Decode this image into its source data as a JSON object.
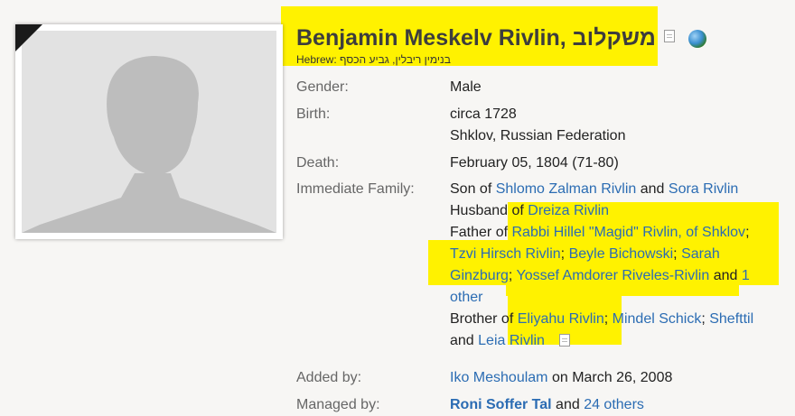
{
  "profile": {
    "name": "Benjamin Meskelv Rivlin, משקלוב",
    "hebrew": "Hebrew: בנימין ריבלין, גביע הכסף"
  },
  "icons": {
    "doc": "document-icon",
    "globe": "globe-icon",
    "avatar": "silhouette-avatar"
  },
  "colors": {
    "highlight": "#fff200",
    "link": "#2b6cb3",
    "label": "#666666"
  },
  "fields": {
    "gender_label": "Gender:",
    "gender": "Male",
    "birth_label": "Birth:",
    "birth_date": "circa 1728",
    "birth_place": "Shklov, Russian Federation",
    "death_label": "Death:",
    "death": "February 05, 1804 (71-80)",
    "family_label": "Immediate Family:",
    "added_label": "Added by:",
    "managed_label": "Managed by:"
  },
  "family": {
    "son_prefix": "Son of ",
    "father_name": "Shlomo Zalman Rivlin",
    "and": " and ",
    "mother_name": "Sora Rivlin",
    "husband_prefix": "Husband of ",
    "spouse": "Dreiza Rivlin",
    "father_prefix": "Father of ",
    "child1": "Rabbi Hillel \"Magid\" Rivlin, of Shklov",
    "sep": "; ",
    "child2": "Tzvi Hirsch Rivlin",
    "child3": "Beyle Bichowski",
    "child4_a": "Sarah",
    "child4_b": "Ginzburg",
    "child5": "Yossef Amdorer Riveles-Rivlin",
    "and_word": " and ",
    "more_a": "1",
    "more_b": "other",
    "brother_prefix": "Brother of ",
    "sib1": "Eliyahu Rivlin",
    "sib2": "Mindel Schick",
    "sib3": "Shefttil",
    "and_start": "and ",
    "sib4": "Leia Rivlin"
  },
  "added": {
    "user": "Iko Meshoulam",
    "on": " on March 26, 2008"
  },
  "managed": {
    "user": "Roni Soffer Tal",
    "and": " and ",
    "others": "24 others"
  }
}
